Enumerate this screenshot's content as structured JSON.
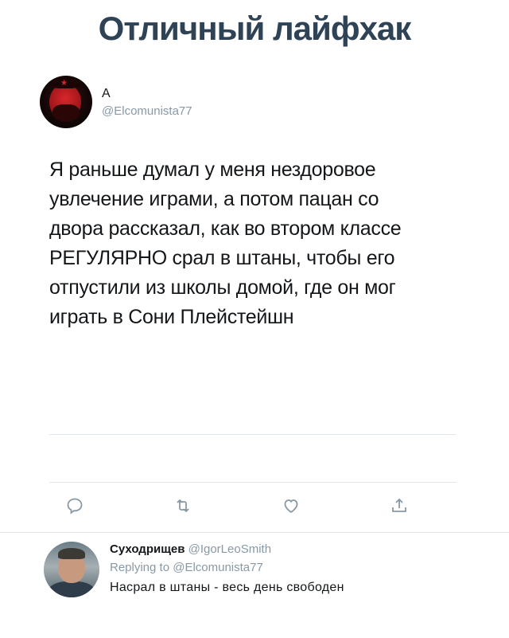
{
  "headline": "Отличный лайфхак",
  "tweet": {
    "author_name": "А",
    "author_handle": "@Elcomunista77",
    "text": "Я раньше думал у меня нездоровое\nувлечение играми, а потом пацан со\nдвора рассказал, как во втором классе\nРЕГУЛЯРНО срал в штаны, чтобы его\nотпустили из школы домой, где он мог\nиграть в Сони Плейстейшн"
  },
  "actions": {
    "icons": [
      "reply-icon",
      "retweet-icon",
      "like-icon",
      "share-icon"
    ]
  },
  "reply": {
    "author_name": "Суходрищев",
    "author_handle": "@IgorLeoSmith",
    "replying_label": "Replying to",
    "replying_handle": "@Elcomunista77",
    "text": "Насрал в штаны - весь день свободен"
  },
  "colors": {
    "headline": "#2f4356",
    "secondary_text": "#8899a6",
    "primary_text": "#14171a"
  }
}
